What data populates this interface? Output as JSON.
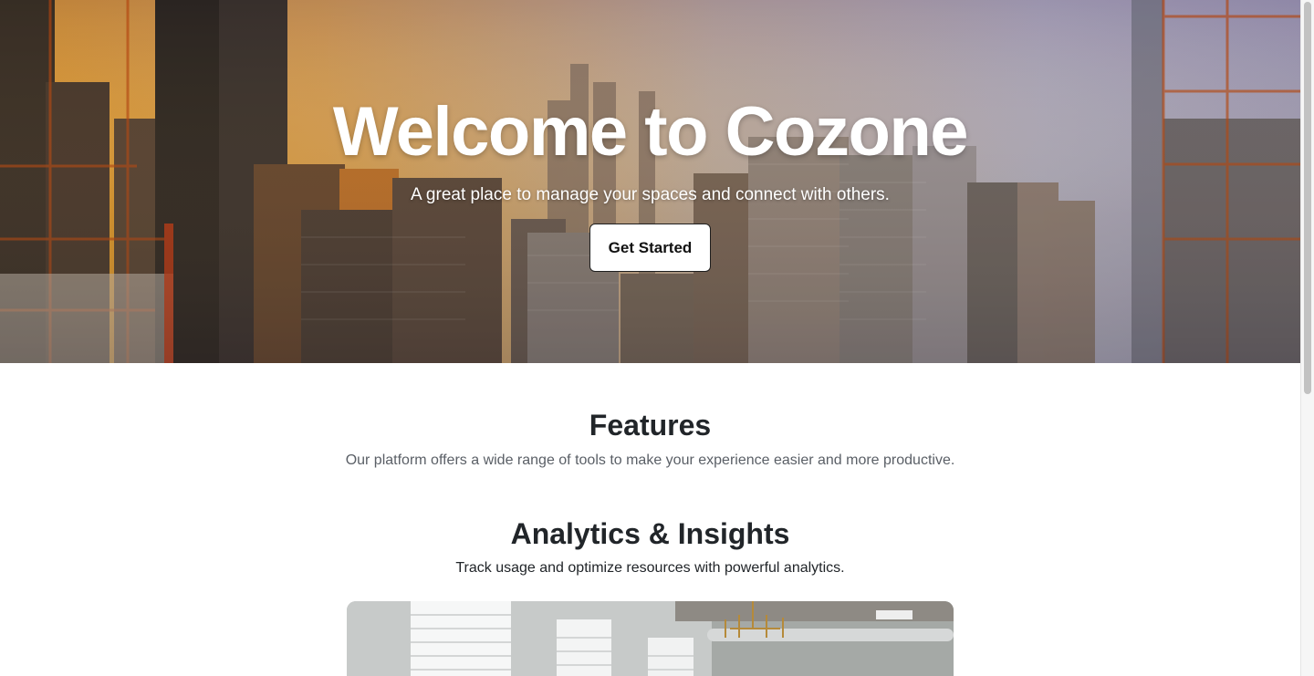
{
  "hero": {
    "title": "Welcome to Cozone",
    "subtitle": "A great place to manage your spaces and connect with others.",
    "cta_label": "Get Started",
    "background_image": "city-skyline-sunset"
  },
  "features": {
    "title": "Features",
    "description": "Our platform offers a wide range of tools to make your experience easier and more productive."
  },
  "feature_section": {
    "title": "Analytics & Insights",
    "description": "Track usage and optimize resources with powerful analytics.",
    "image": "office-interior-with-chandelier"
  },
  "colors": {
    "text_primary": "#212529",
    "text_muted": "#5a5f66",
    "hero_text": "#ffffff",
    "button_bg": "#ffffff"
  }
}
